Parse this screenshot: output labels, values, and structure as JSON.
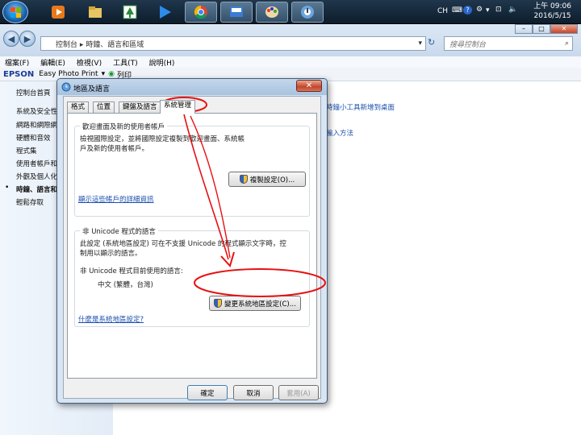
{
  "taskbar": {
    "tray_lang": "CH",
    "clock_time": "上午 09:06",
    "clock_date": "2016/5/15"
  },
  "explorer": {
    "breadcrumb": "控制台 ▸ 時鐘、語言和區域",
    "search_placeholder": "搜尋控制台",
    "menu": [
      "檔案(F)",
      "編輯(E)",
      "檢視(V)",
      "工具(T)",
      "說明(H)"
    ],
    "epson_brand": "EPSON",
    "epson_app": "Easy Photo Print",
    "epson_print": "列印",
    "sidebar": [
      "控制台首頁",
      "系統及安全性",
      "網路和網際網",
      "硬體和音效",
      "程式集",
      "使用者帳戶和",
      "外觀及個人化",
      "時鐘、語言和",
      "輕鬆存取"
    ],
    "main_links": [
      "時鐘小工具新增到桌面",
      "輸入方法"
    ]
  },
  "dialog": {
    "title": "地區及語言",
    "close": "✕",
    "tabs": [
      "格式",
      "位置",
      "鍵盤及語言",
      "系統管理"
    ],
    "welcome_group_title": "歡迎畫面及新的使用者帳戶",
    "welcome_text": "檢視國際設定，並將國際設定複製到歡迎畫面、系統帳戶及新的使用者帳戶。",
    "copy_button": "複製設定(O)...",
    "reserved_link": "顯示這些帳戶的詳細資訊",
    "unicode_group_title": "非 Unicode 程式的語言",
    "unicode_text": "此設定 (系統地區設定) 可在不支援 Unicode 的程式顯示文字時，控制用以顯示的語言。",
    "current_label": "非 Unicode 程式目前使用的語言:",
    "current_value": "中文 (繁體，台灣)",
    "change_button": "變更系統地區設定(C)...",
    "what_link": "什麼是系統地區設定?",
    "ok": "確定",
    "cancel": "取消",
    "apply": "套用(A)"
  },
  "colors": {
    "annotation_red": "#e81010",
    "link_blue": "#1a4fae"
  }
}
